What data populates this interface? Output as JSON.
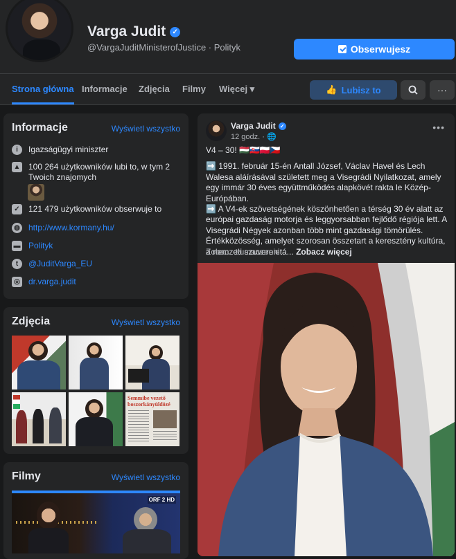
{
  "profile": {
    "name": "Varga Judit",
    "handle": "@VargaJuditMinisterofJustice · Polityk",
    "follow_button": "Obserwujesz"
  },
  "nav": {
    "tabs": [
      "Strona główna",
      "Informacje",
      "Zdjęcia",
      "Filmy",
      "Więcej ▾"
    ],
    "active_tab": "Strona główna",
    "like_button": "Lubisz to",
    "search_icon": "⌕",
    "more_icon": "···"
  },
  "info": {
    "title": "Informacje",
    "see_all": "Wyświetl wszystko",
    "rows": [
      {
        "icon": "info-icon",
        "text": "Igazságügyi miniszter"
      },
      {
        "icon": "thumbs-up-icon",
        "text": "100 264 użytkowników lubi to, w tym 2 Twoich znajomych"
      },
      {
        "icon": "follow-check-icon",
        "text": "121 479 użytkowników obserwuje to"
      },
      {
        "icon": "globe-icon",
        "text": "http://www.kormany.hu/"
      },
      {
        "icon": "category-icon",
        "text": "Polityk"
      },
      {
        "icon": "twitter-icon",
        "text": "@JuditVarga_EU"
      },
      {
        "icon": "instagram-icon",
        "text": "dr.varga.judit"
      }
    ]
  },
  "photos": {
    "title": "Zdjęcia",
    "see_all": "Wyświetl wszystko",
    "newspaper_headline": "Semmibe vezető boszorkányüldözé"
  },
  "videos": {
    "title": "Filmy",
    "see_all": "Wyświetl wszystko",
    "badge": "ORF 2 HD"
  },
  "post": {
    "author": "Varga Judit",
    "time": "12 godz. · 🌐",
    "headline": "V4 – 30! 🇭🇺🇸🇰🇵🇱🇨🇿",
    "paragraph1": "➡️ 1991. február 15-én Antall József, Václav Havel és Lech Walesa aláírásával született meg a Visegrádi Nyilatkozat, amely egy immár 30 éves együttműködés alapkövét rakta le Közép-Európában.",
    "paragraph2": "➡️ A V4-ek szövetségének köszönhetően a térség 30 év alatt az európai gazdaság motorja és leggyorsabban fejlődő régiója lett. A Visegrádi Négyek azonban több mint gazdasági tömörülés. Értékközösség, amelyet szorosan összetart a keresztény kultúra, a nemzeti szuverenitá...",
    "see_more": "Zobacz więcej",
    "translate": "Zobacz tłumaczenie"
  },
  "colors": {
    "accent": "#2d88ff",
    "background": "#18191a",
    "card": "#242526"
  }
}
